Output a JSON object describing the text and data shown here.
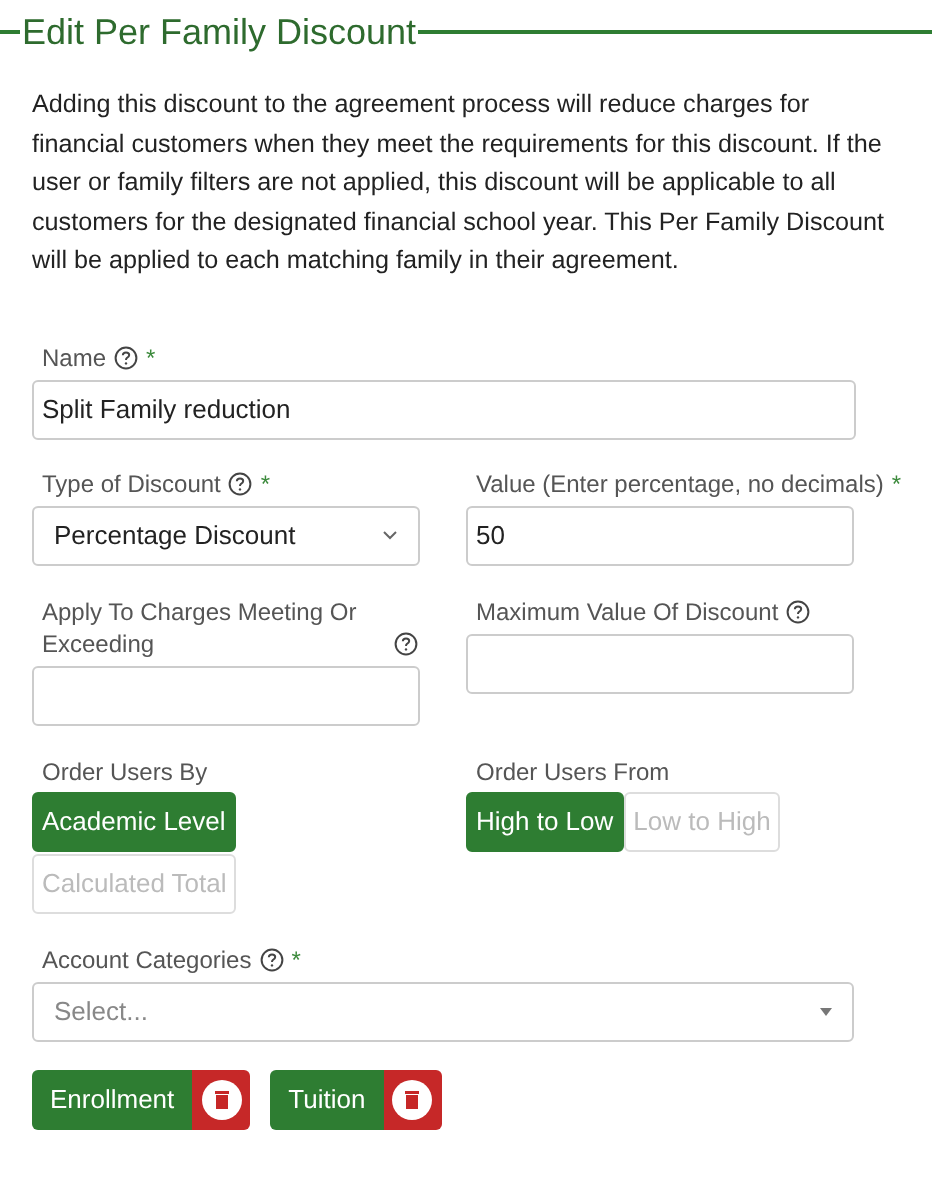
{
  "title": "Edit Per Family Discount",
  "description": "Adding this discount to the agreement process will reduce charges for financial customers when they meet the requirements for this discount. If the user or family filters are not applied, this discount will be applicable to all customers for the designated financial school year. This Per Family Discount will be applied to each matching family in their agreement.",
  "name_field": {
    "label": "Name",
    "help": true,
    "required_mark": "*",
    "value": "Split Family reduction"
  },
  "rows": [
    [
      {
        "kind": "select",
        "label": "Type of Discount",
        "help": true,
        "required_mark": "*",
        "value": "Percentage Discount"
      },
      {
        "kind": "input",
        "label": "Value (Enter percentage, no decimals)",
        "required_mark": "*",
        "value": "50"
      }
    ],
    [
      {
        "kind": "input",
        "label": "Apply To Charges Meeting Or Exceeding",
        "help": true
      },
      {
        "kind": "input",
        "label": "Maximum Value Of Discount",
        "help": true
      }
    ],
    [
      {
        "kind": "toggle",
        "label": "Order Users By",
        "stacked": true,
        "options": [
          {
            "label": "Academic Level",
            "selected": true
          },
          {
            "label": "Calculated Total",
            "selected": false
          }
        ]
      },
      {
        "kind": "toggle",
        "label": "Order Users From",
        "stacked": false,
        "options": [
          {
            "label": "High to Low",
            "selected": true
          },
          {
            "label": "Low to High",
            "selected": false
          }
        ]
      }
    ]
  ],
  "account_categories": {
    "label": "Account Categories",
    "help": true,
    "required_mark": "*",
    "placeholder": "Select...",
    "tags": [
      "Enrollment",
      "Tuition"
    ]
  }
}
